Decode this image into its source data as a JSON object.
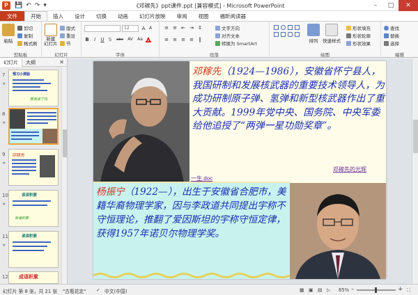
{
  "window": {
    "title": "《邓稼先》ppt课件.ppt [兼容模式] - Microsoft PowerPoint",
    "app_icon_letter": "P"
  },
  "quick_access": [
    "save",
    "undo",
    "redo",
    "customize"
  ],
  "ribbon_tabs": [
    "文件",
    "开始",
    "插入",
    "设计",
    "切换",
    "动画",
    "幻灯片放映",
    "审阅",
    "视图",
    "福昕阅读器"
  ],
  "ribbon": {
    "clipboard": {
      "paste": "粘贴",
      "cut": "剪切",
      "copy": "复制",
      "format_painter": "格式刷",
      "label": "剪贴板"
    },
    "slides": {
      "new_slide": "新建\n幻灯片",
      "layout": "版式",
      "reset": "重设",
      "section": "节",
      "label": "幻灯片"
    },
    "font": {
      "font_size": "12",
      "label": "字体",
      "bold": "B",
      "italic": "I",
      "underline": "U",
      "strike": "S",
      "shadow": "abc",
      "spacing": "AV",
      "case": "Aa",
      "color": "A"
    },
    "paragraph": {
      "text_direction": "文字方向",
      "align_text": "对齐文本",
      "smartart": "转换为 SmartArt",
      "label": "段落"
    },
    "drawing": {
      "arrange": "排列",
      "quick_styles": "快速样式",
      "shape_fill": "形状填充",
      "shape_outline": "形状轮廓",
      "shape_effects": "形状效果",
      "label": "绘图"
    },
    "editing": {
      "find": "查找",
      "replace": "替换",
      "select": "选择",
      "label": "编辑"
    }
  },
  "left_pane": {
    "tabs": [
      "幻灯片",
      "大纲"
    ],
    "thumbnails": [
      {
        "num": "7",
        "selected": false
      },
      {
        "num": "8",
        "selected": true
      },
      {
        "num": "9",
        "selected": false
      },
      {
        "num": "10",
        "selected": false
      },
      {
        "num": "11",
        "selected": false
      },
      {
        "num": "12",
        "selected": false
      }
    ],
    "thumb_texts": {
      "t7_title": "预习小测验",
      "t7_caption": "教我读了吗",
      "t9_title": "邓稼先",
      "t10_title": "读读积累",
      "t10_caption": "背诵积累",
      "t11_title": "读读积累",
      "t12_title": "成语积累"
    }
  },
  "slide": {
    "bio1_name": "邓稼先",
    "bio1_text": "（1924—1986），安徽省怀宁县人，我国研制和发展核武器的重要技术领导人，为成功研制原子弹、氢弹和新型核武器作出了重大贡献。1999年党中央、国务院、中央军委给他追授了“两弹一星功勋奖章”。",
    "link1_a": "邓稼先的光辉",
    "link1_b": "一生.doc",
    "bio2_name": "杨振宁",
    "bio2_text": "（1922—），出生于安徽省合肥市，美籍华裔物理学家，因与李政道共同提出宇称不守恒理论，推翻了爱因斯坦的宇称守恒定律，获得1957年诺贝尔物理学奖。"
  },
  "statusbar": {
    "slide_info": "幻灯片 第 8 张，共 21 张",
    "theme": "\"古瓶花定\"",
    "language": "中文(中国)",
    "zoom": "85%"
  },
  "colors": {
    "file_tab": "#c43e1c",
    "bio_text": "#1a2fae",
    "bio_name": "#d3331e",
    "slide_bg": "#fffdea",
    "bio2_bg": "#c8f2ee"
  }
}
